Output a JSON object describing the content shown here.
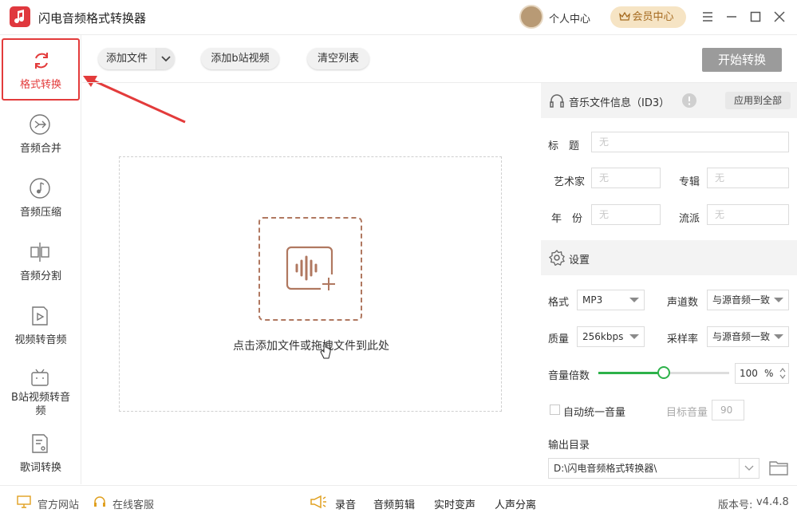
{
  "app": {
    "title": "闪电音频格式转换器",
    "version_label": "版本号:",
    "version": "v4.4.8"
  },
  "header": {
    "user_center": "个人中心",
    "vip_center": "会员中心"
  },
  "sidebar": {
    "items": [
      {
        "label": "格式转换"
      },
      {
        "label": "音频合并"
      },
      {
        "label": "音频压缩"
      },
      {
        "label": "音频分割"
      },
      {
        "label": "视频转音频"
      },
      {
        "label": "B站视频转音频"
      },
      {
        "label": "歌词转换"
      }
    ]
  },
  "toolbar": {
    "add_file": "添加文件",
    "add_bilibili": "添加b站视频",
    "clear_list": "清空列表",
    "start": "开始转换"
  },
  "dropzone": {
    "hint": "点击添加文件或拖拽文件到此处"
  },
  "id3": {
    "title": "音乐文件信息（ID3）",
    "apply_all": "应用到全部",
    "fields": {
      "title_label": "标　题",
      "artist_label": "艺术家",
      "album_label": "专辑",
      "year_label": "年　份",
      "genre_label": "流派",
      "placeholder": "无"
    }
  },
  "settings": {
    "title": "设置",
    "format_label": "格式",
    "format_value": "MP3",
    "channels_label": "声道数",
    "channels_value": "与源音频一致",
    "quality_label": "质量",
    "quality_value": "256kbps",
    "samplerate_label": "采样率",
    "samplerate_value": "与源音频一致",
    "volume_label": "音量倍数",
    "volume_value": "100",
    "volume_unit": "%",
    "volume_fraction": 0.5,
    "auto_volume_label": "自动统一音量",
    "target_volume_label": "目标音量",
    "target_volume_value": "90",
    "output_label": "输出目录",
    "output_path": "D:\\闪电音频格式转换器\\"
  },
  "statusbar": {
    "website": "官方网站",
    "support": "在线客服",
    "tools": [
      "录音",
      "音频剪辑",
      "实时变声",
      "人声分离"
    ]
  }
}
